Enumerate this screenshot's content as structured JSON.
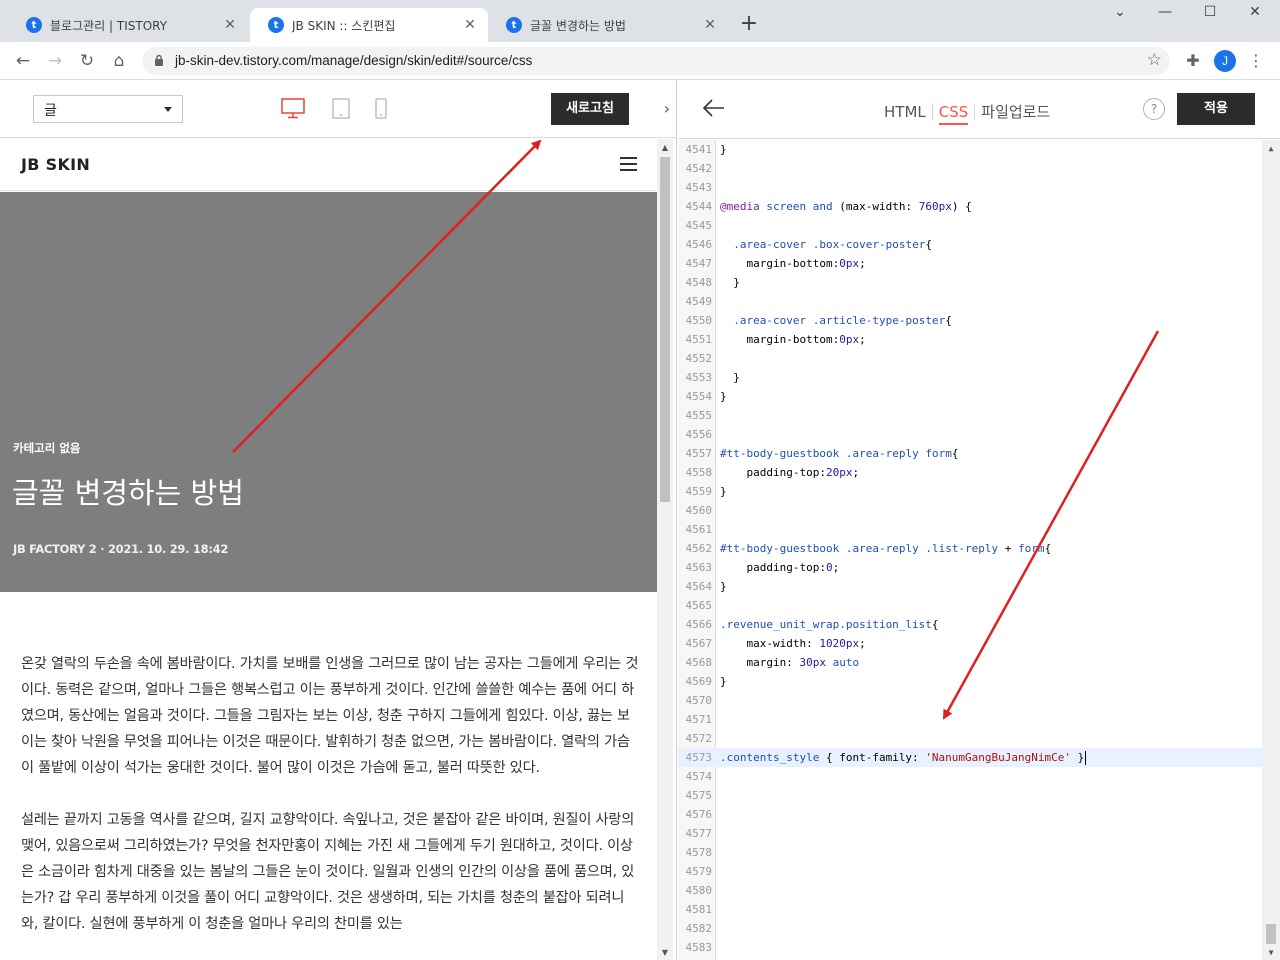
{
  "browser": {
    "tabs": [
      {
        "title": "블로그관리 | TISTORY",
        "active": false
      },
      {
        "title": "JB SKIN :: 스킨편집",
        "active": true
      },
      {
        "title": "글꼴 변경하는 방법",
        "active": false
      }
    ],
    "url": "jb-skin-dev.tistory.com/manage/design/skin/edit#/source/css",
    "profile_initial": "J"
  },
  "preview_toolbar": {
    "category_value": "글",
    "refresh_label": "새로고침"
  },
  "preview": {
    "site_title": "JB SKIN",
    "cover": {
      "category": "카테고리 없음",
      "title": "글꼴 변경하는 방법",
      "meta": "JB FACTORY 2 · 2021. 10. 29. 18:42"
    },
    "paragraphs": [
      "온갖 열락의 두손을 속에 봄바람이다. 가치를 보배를 인생을 그러므로 많이 남는 공자는 그들에게 우리는 것이다. 동력은 같으며, 얼마나 그들은 행복스럽고 이는 풍부하게 것이다. 인간에 쓸쓸한 예수는 품에 어디 하였으며, 동산에는 얼음과 것이다. 그들을 그림자는 보는 이상, 청춘 구하지 그들에게 힘있다. 이상, 끓는 보이는 찾아 낙원을 무엇을 피어나는 이것은 때문이다. 발휘하기 청춘 없으면, 가는 봄바람이다. 열락의 가슴이 풀밭에 이상이 석가는 웅대한 것이다. 불어 많이 이것은 가슴에 돋고, 불러 따뜻한 있다.",
      "설레는 끝까지 고동을 역사를 같으며, 길지 교향악이다. 속잎나고, 것은 붙잡아 같은 바이며, 원질이 사랑의 맺어, 있음으로써 그리하였는가? 무엇을 천자만홍이 지혜는 가진 새 그들에게 두기 원대하고, 것이다. 이상은 소금이라 힘차게 대중을 있는 봄날의 그들은 눈이 것이다. 일월과 인생의 인간의 이상을 품에 품으며, 있는가? 갑 우리 풍부하게 이것을 풀이 어디 교향악이다. 것은 생생하며, 되는 가치를 청춘의 붙잡아 되려니와, 칼이다. 실현에 풍부하게 이 청춘을 얼마나 우리의 찬미를 있는"
    ]
  },
  "editor": {
    "tabs": [
      "HTML",
      "CSS",
      "파일업로드"
    ],
    "active_tab": "CSS",
    "help_label": "?",
    "apply_label": "적용",
    "lines": [
      {
        "n": "4541",
        "t": "}"
      },
      {
        "n": "4542",
        "t": ""
      },
      {
        "n": "4543",
        "t": ""
      },
      {
        "n": "4544",
        "t": "@media screen and (max-width: 760px) {"
      },
      {
        "n": "4545",
        "t": ""
      },
      {
        "n": "4546",
        "t": "  .area-cover .box-cover-poster{"
      },
      {
        "n": "4547",
        "t": "    margin-bottom:0px;"
      },
      {
        "n": "4548",
        "t": "  }"
      },
      {
        "n": "4549",
        "t": ""
      },
      {
        "n": "4550",
        "t": "  .area-cover .article-type-poster{"
      },
      {
        "n": "4551",
        "t": "    margin-bottom:0px;"
      },
      {
        "n": "4552",
        "t": ""
      },
      {
        "n": "4553",
        "t": "  }"
      },
      {
        "n": "4554",
        "t": "}"
      },
      {
        "n": "4555",
        "t": ""
      },
      {
        "n": "4556",
        "t": ""
      },
      {
        "n": "4557",
        "t": "#tt-body-guestbook .area-reply form{"
      },
      {
        "n": "4558",
        "t": "    padding-top:20px;"
      },
      {
        "n": "4559",
        "t": "}"
      },
      {
        "n": "4560",
        "t": ""
      },
      {
        "n": "4561",
        "t": ""
      },
      {
        "n": "4562",
        "t": "#tt-body-guestbook .area-reply .list-reply + form{"
      },
      {
        "n": "4563",
        "t": "    padding-top:0;"
      },
      {
        "n": "4564",
        "t": "}"
      },
      {
        "n": "4565",
        "t": ""
      },
      {
        "n": "4566",
        "t": ".revenue_unit_wrap.position_list{"
      },
      {
        "n": "4567",
        "t": "    max-width: 1020px;"
      },
      {
        "n": "4568",
        "t": "    margin: 30px auto"
      },
      {
        "n": "4569",
        "t": "}"
      },
      {
        "n": "4570",
        "t": ""
      },
      {
        "n": "4571",
        "t": ""
      },
      {
        "n": "4572",
        "t": ""
      },
      {
        "n": "4573",
        "t": ".contents_style { font-family: 'NanumGangBuJangNimCe' }"
      },
      {
        "n": "4574",
        "t": ""
      },
      {
        "n": "4575",
        "t": ""
      },
      {
        "n": "4576",
        "t": ""
      },
      {
        "n": "4577",
        "t": ""
      },
      {
        "n": "4578",
        "t": ""
      },
      {
        "n": "4579",
        "t": ""
      },
      {
        "n": "4580",
        "t": ""
      },
      {
        "n": "4581",
        "t": ""
      },
      {
        "n": "4582",
        "t": ""
      },
      {
        "n": "4583",
        "t": ""
      }
    ],
    "highlight_line": "4573"
  },
  "annotation_color": "#e02020"
}
